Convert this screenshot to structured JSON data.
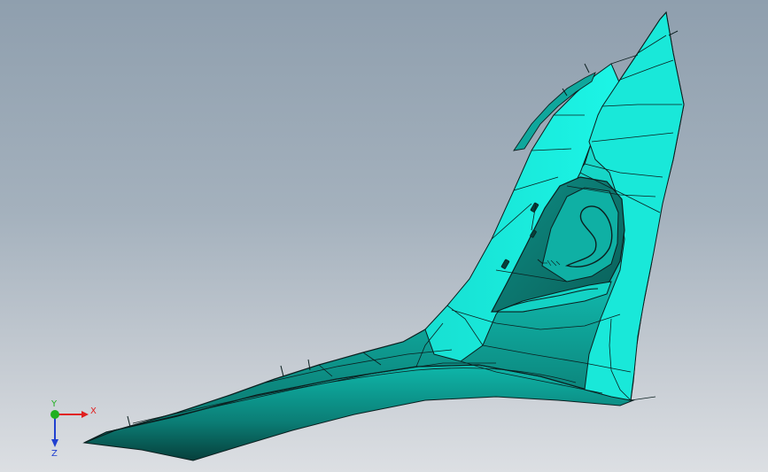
{
  "viewport": {
    "background_top": "#8f9fae",
    "background_bottom": "#dcdfe3"
  },
  "part": {
    "surface_color": "#16e3d4",
    "shadow_color": "#0a6e66",
    "edge_color": "#0b1f1f"
  },
  "triad": {
    "x_label": "X",
    "y_label": "Y",
    "z_label": "Z",
    "x_color": "#e02020",
    "y_color": "#20b020",
    "z_color": "#2040d0"
  }
}
